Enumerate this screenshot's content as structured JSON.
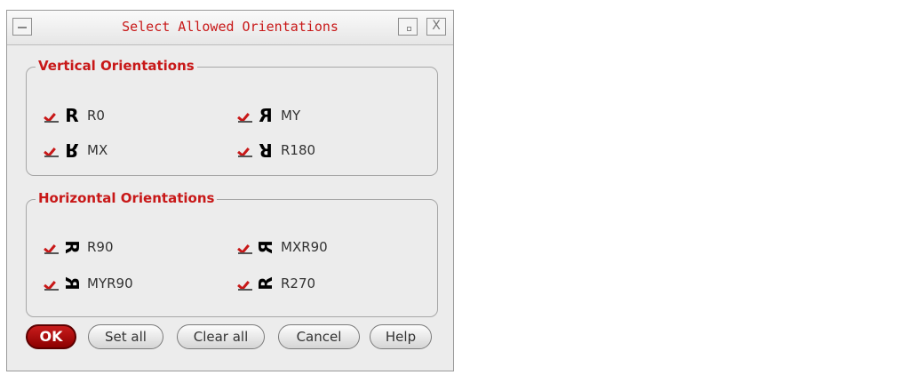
{
  "window": {
    "title": "Select Allowed Orientations",
    "close_symbol": "X"
  },
  "vertical": {
    "legend": "Vertical Orientations",
    "options": [
      {
        "glyph": "R",
        "label": "R0",
        "checked": true
      },
      {
        "glyph": "R",
        "label": "MY",
        "checked": true
      },
      {
        "glyph": "R",
        "label": "MX",
        "checked": true
      },
      {
        "glyph": "R",
        "label": "R180",
        "checked": true
      }
    ]
  },
  "horizontal": {
    "legend": "Horizontal Orientations",
    "options": [
      {
        "glyph": "R",
        "label": "R90",
        "checked": true
      },
      {
        "glyph": "R",
        "label": "MXR90",
        "checked": true
      },
      {
        "glyph": "R",
        "label": "MYR90",
        "checked": true
      },
      {
        "glyph": "R",
        "label": "R270",
        "checked": true
      }
    ]
  },
  "buttons": {
    "ok": "OK",
    "set_all": "Set all",
    "clear_all": "Clear all",
    "cancel": "Cancel",
    "help": "Help"
  },
  "colors": {
    "accent": "#c81818",
    "ok_button": "#a00000",
    "background": "#ececec"
  }
}
